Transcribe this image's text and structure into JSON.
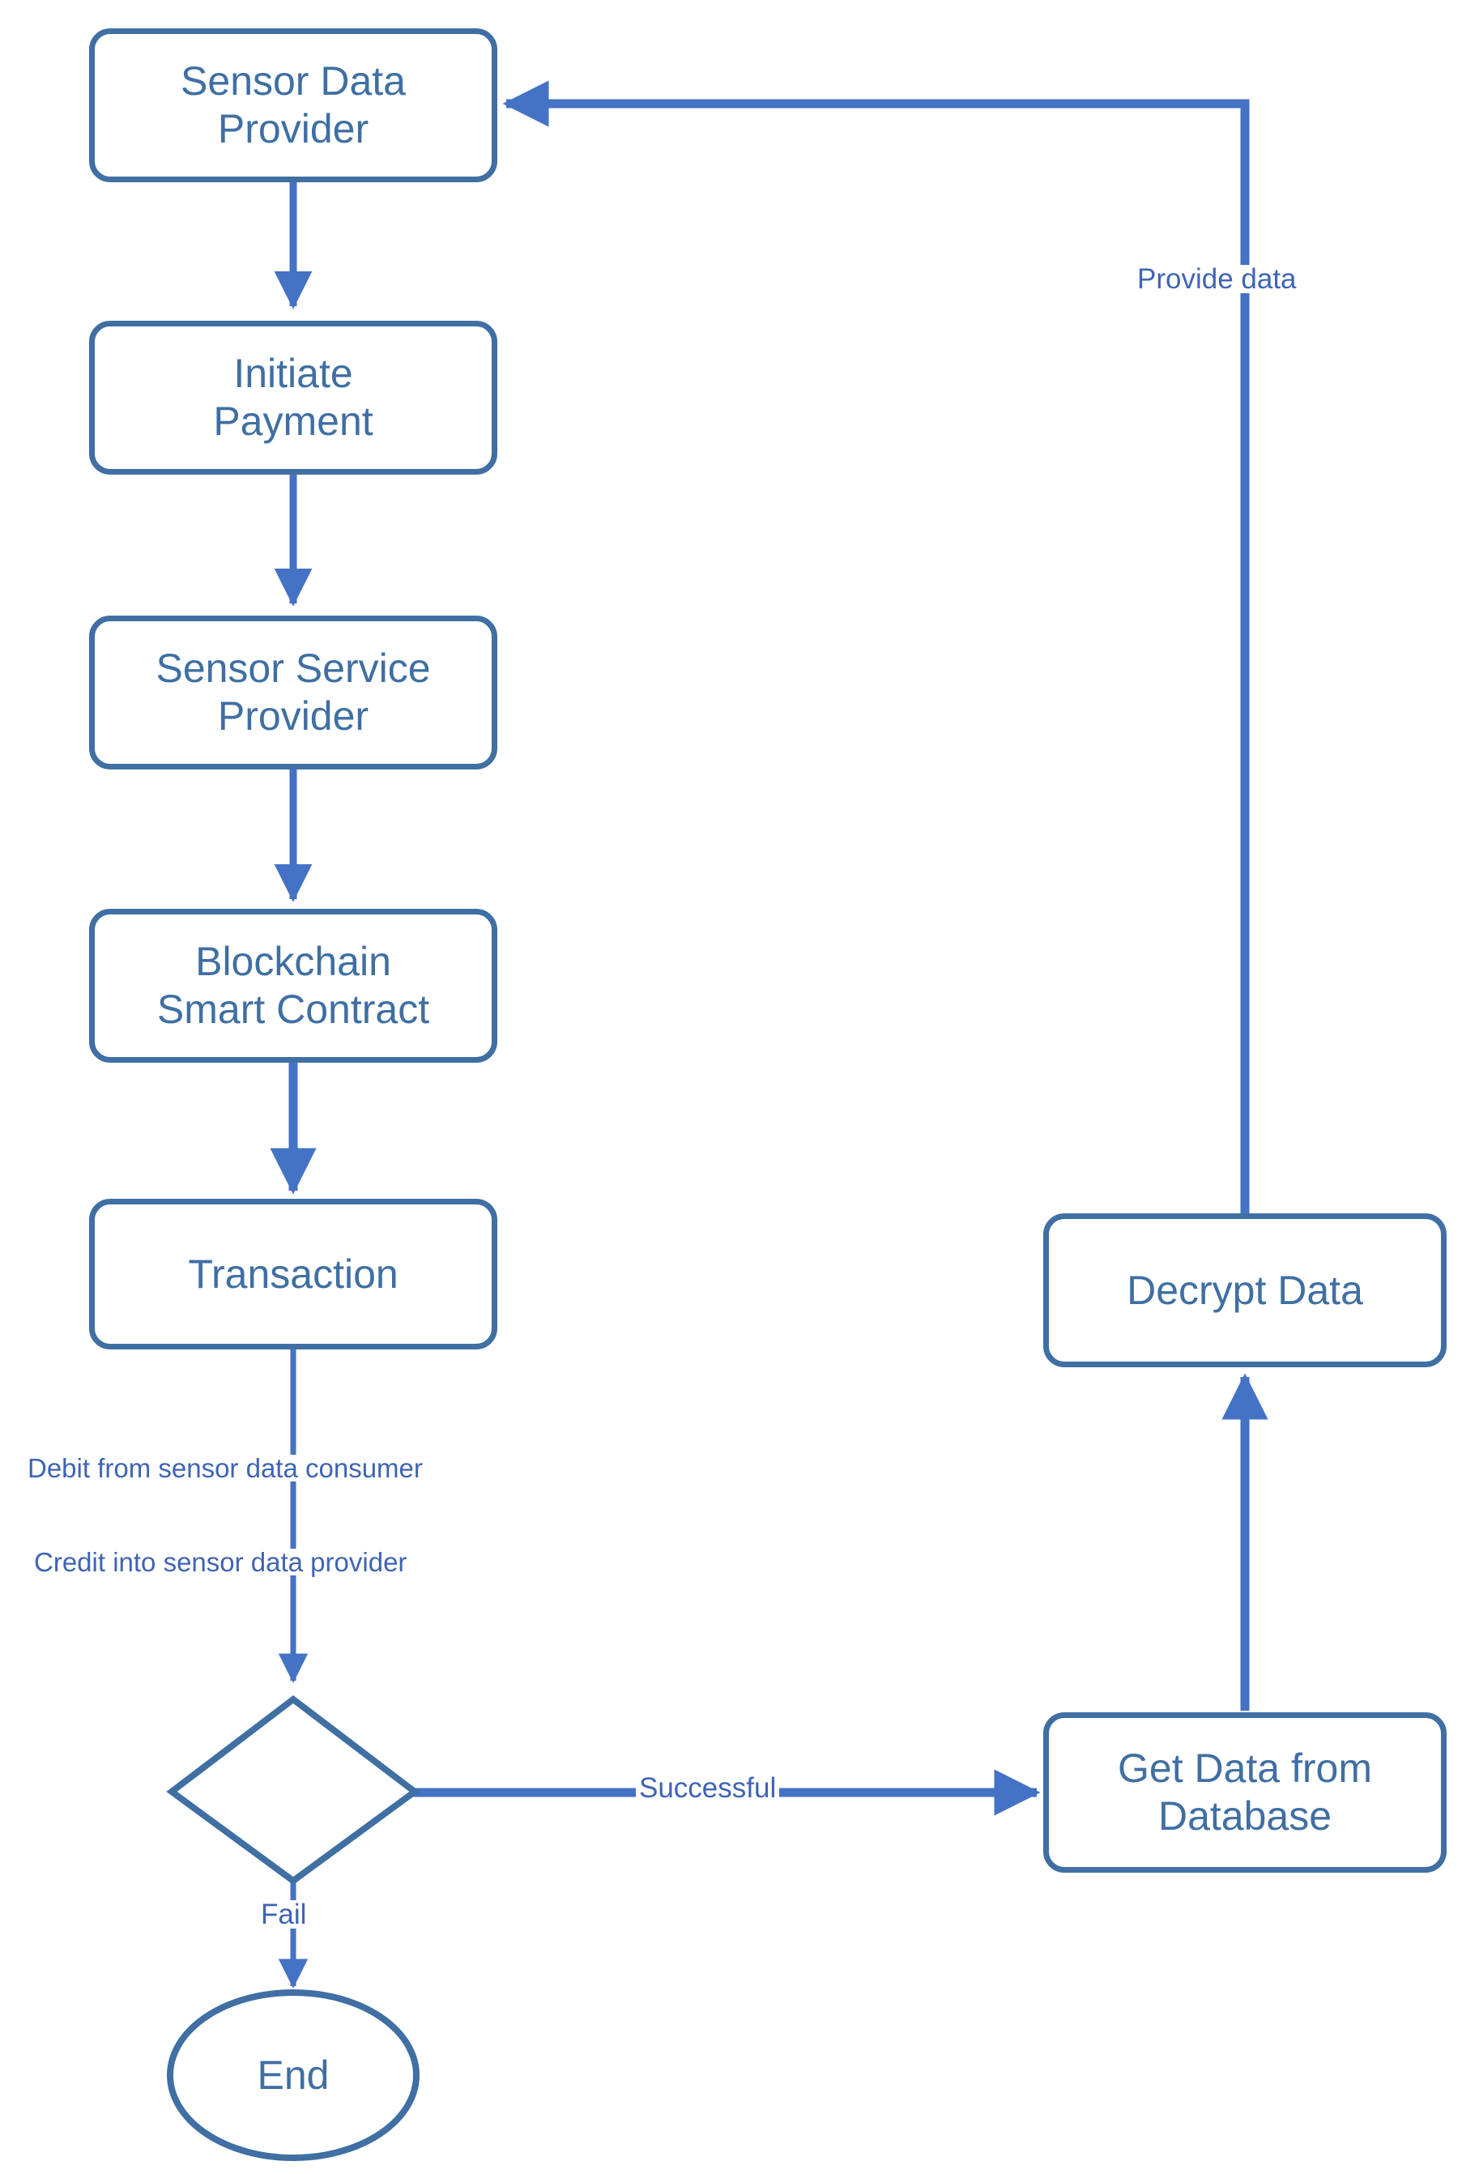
{
  "diagram": {
    "title": "Sensor data payment and delivery flowchart",
    "colors": {
      "node_border": "#3F6FA3",
      "node_text": "#3F6FA3",
      "edge": "#4472C4",
      "edge_label_text": "#3F64B4",
      "background": "#FFFFFF"
    },
    "nodes": [
      {
        "id": "sensor-data-provider",
        "label": "Sensor Data\nProvider",
        "shape": "rounded-rect"
      },
      {
        "id": "initiate-payment",
        "label": "Initiate\nPayment",
        "shape": "rounded-rect"
      },
      {
        "id": "sensor-service-provider",
        "label": "Sensor Service\nProvider",
        "shape": "rounded-rect"
      },
      {
        "id": "blockchain-smart-contract",
        "label": "Blockchain\nSmart Contract",
        "shape": "rounded-rect"
      },
      {
        "id": "transaction",
        "label": "Transaction",
        "shape": "rounded-rect"
      },
      {
        "id": "decision",
        "label": "",
        "shape": "diamond"
      },
      {
        "id": "end",
        "label": "End",
        "shape": "ellipse"
      },
      {
        "id": "get-data-from-database",
        "label": "Get Data from\nDatabase",
        "shape": "rounded-rect"
      },
      {
        "id": "decrypt-data",
        "label": "Decrypt Data",
        "shape": "rounded-rect"
      }
    ],
    "edge_labels": {
      "provide_data": "Provide data",
      "debit": "Debit from sensor data consumer",
      "credit": "Credit into sensor data provider",
      "successful": "Successful",
      "fail": "Fail"
    },
    "edges": [
      {
        "from": "sensor-data-provider",
        "to": "initiate-payment",
        "label": ""
      },
      {
        "from": "initiate-payment",
        "to": "sensor-service-provider",
        "label": ""
      },
      {
        "from": "sensor-service-provider",
        "to": "blockchain-smart-contract",
        "label": ""
      },
      {
        "from": "blockchain-smart-contract",
        "to": "transaction",
        "label": ""
      },
      {
        "from": "transaction",
        "to": "decision",
        "label": "Debit from sensor data consumer / Credit into sensor data provider"
      },
      {
        "from": "decision",
        "to": "get-data-from-database",
        "label": "Successful"
      },
      {
        "from": "decision",
        "to": "end",
        "label": "Fail"
      },
      {
        "from": "get-data-from-database",
        "to": "decrypt-data",
        "label": ""
      },
      {
        "from": "decrypt-data",
        "to": "sensor-data-provider",
        "label": "Provide data"
      }
    ]
  }
}
